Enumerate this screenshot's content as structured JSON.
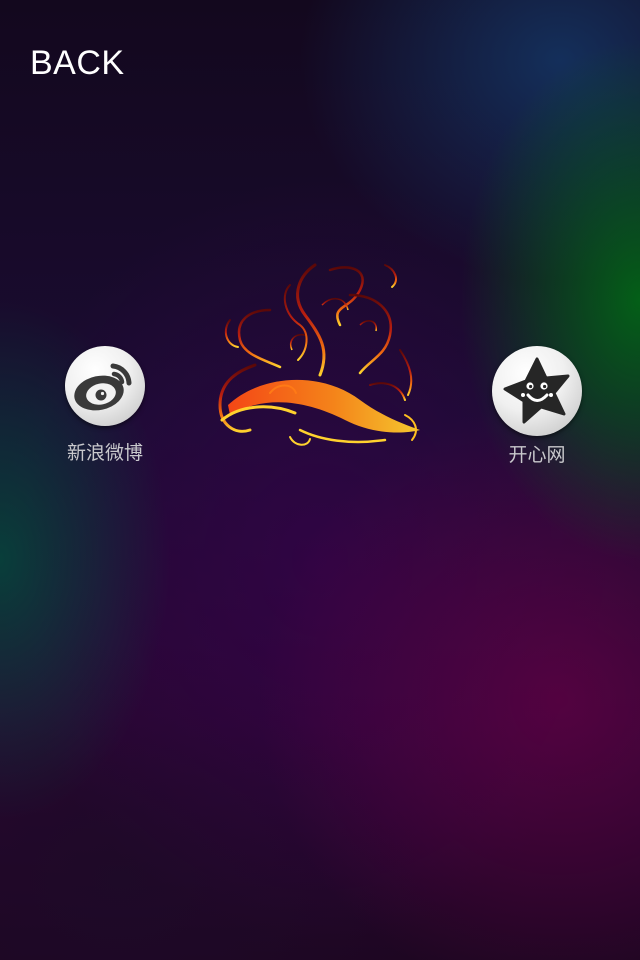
{
  "header": {
    "back_label": "BACK"
  },
  "share": {
    "items": [
      {
        "label": "新浪微博",
        "icon": "weibo-icon"
      },
      {
        "label": "开心网",
        "icon": "kaixin-star-icon"
      }
    ]
  },
  "decoration": {
    "icon": "flourish-ornament",
    "colors": {
      "dark_red": "#8a1010",
      "orange": "#f06a10",
      "yellow": "#ffd22e"
    }
  }
}
